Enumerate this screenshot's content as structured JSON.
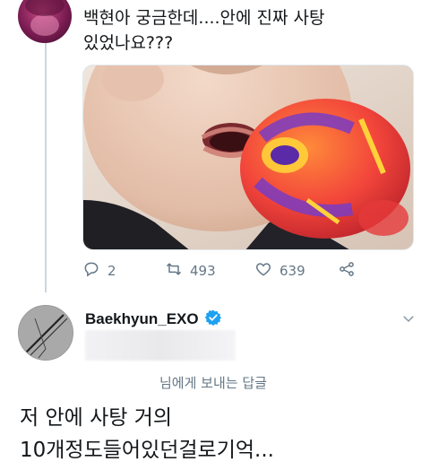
{
  "tweet1": {
    "text": "백현아 궁금한데....안에 진짜 사탕\n있었나요???",
    "actions": {
      "reply_count": "2",
      "retweet_count": "493",
      "like_count": "639"
    },
    "icons": [
      "reply-icon",
      "retweet-icon",
      "heart-icon",
      "share-icon"
    ]
  },
  "tweet2": {
    "display_name": "Baekhyun_EXO",
    "verified": true,
    "reply_to_text": "님에게 보내는 답글",
    "text": "저 안에 사탕 거의\n10개정도들어있던걸로기억...",
    "icons": [
      "verified-badge-icon",
      "chevron-down-icon"
    ]
  },
  "colors": {
    "text": "#14171a",
    "muted": "#657786",
    "verified_blue": "#1da1f2",
    "thread_line": "#ccd6dd"
  }
}
